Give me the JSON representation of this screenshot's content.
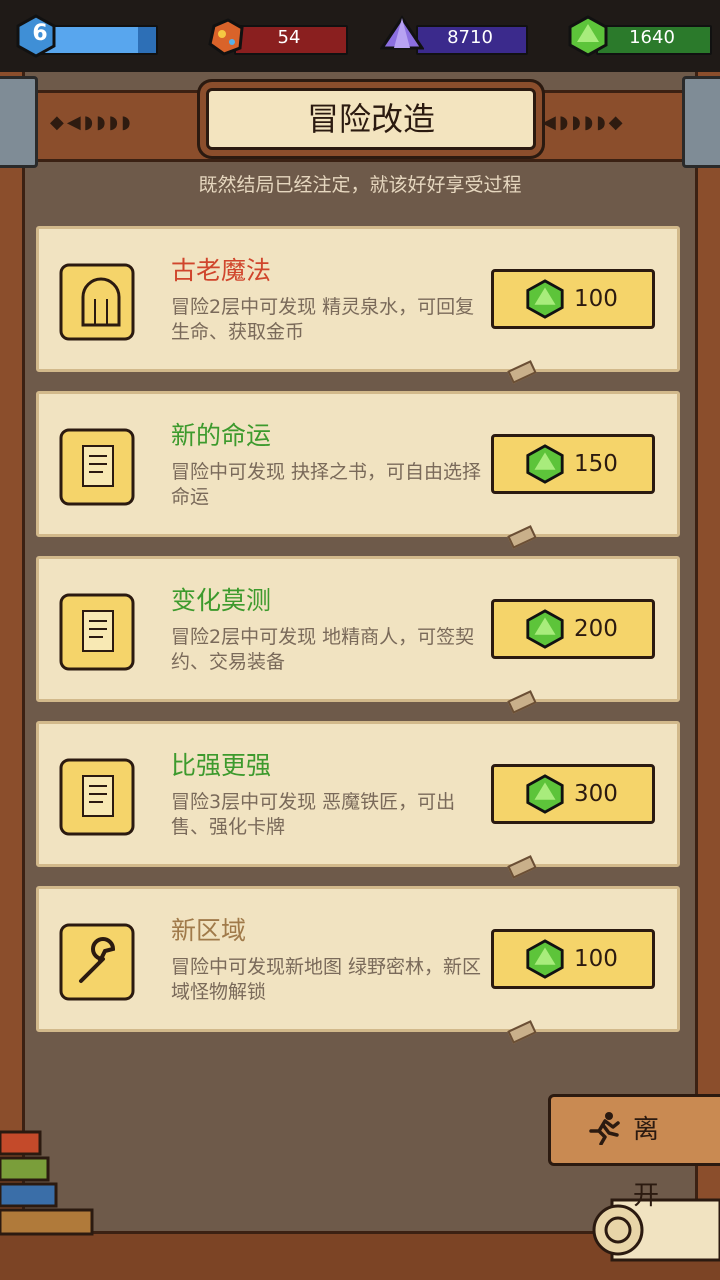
{
  "resources": {
    "level": {
      "value": "6",
      "progress": 0.85,
      "icon": "level-badge-icon"
    },
    "ore": {
      "value": "54",
      "icon": "ore-icon"
    },
    "crystal": {
      "value": "8710",
      "icon": "purple-crystal-icon"
    },
    "gem": {
      "value": "1640",
      "icon": "green-gem-icon"
    }
  },
  "header": {
    "title": "冒险改造",
    "subtitle": "既然结局已经注定，就该好好享受过程"
  },
  "upgrades": [
    {
      "name": "古老魔法",
      "desc": "冒险2层中可发现 精灵泉水，可回复生命、获取金币",
      "price": "100",
      "name_color": "#d0452c",
      "icon": "gate-scroll-icon"
    },
    {
      "name": "新的命运",
      "desc": "冒险中可发现 抉择之书，可自由选择命运",
      "price": "150",
      "name_color": "#3d9a2d",
      "icon": "document-scroll-icon"
    },
    {
      "name": "变化莫测",
      "desc": "冒险2层中可发现 地精商人，可签契约、交易装备",
      "price": "200",
      "name_color": "#3d9a2d",
      "icon": "document-scroll-icon"
    },
    {
      "name": "比强更强",
      "desc": "冒险3层中可发现 恶魔铁匠，可出售、强化卡牌",
      "price": "300",
      "name_color": "#3d9a2d",
      "icon": "document-scroll-icon"
    },
    {
      "name": "新区域",
      "desc": "冒险中可发现新地图 绿野密林，新区域怪物解锁",
      "price": "100",
      "name_color": "#a07a4a",
      "icon": "wrench-scroll-icon"
    }
  ],
  "leave_button": {
    "label": "离 开",
    "icon": "running-man-icon"
  },
  "colors": {
    "wood": "#8b4e2c",
    "parchment": "#f1e3c1",
    "button": "#f5d46a"
  }
}
